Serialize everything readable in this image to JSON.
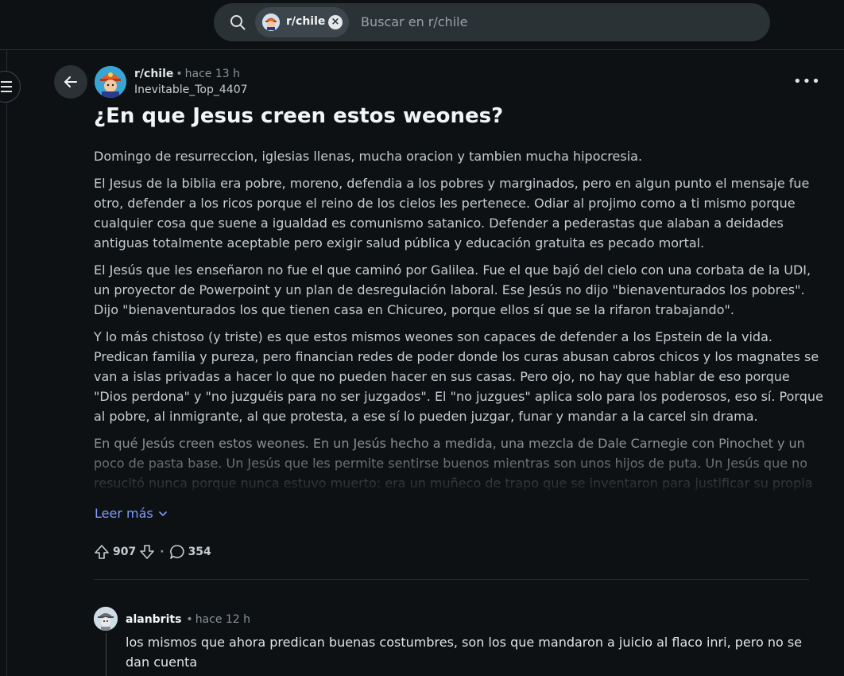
{
  "search": {
    "chip_label": "r/chile",
    "placeholder": "Buscar en r/chile"
  },
  "post": {
    "subreddit": "r/chile",
    "time": "hace 13 h",
    "author": "Inevitable_Top_4407",
    "title": "¿En que Jesus creen estos weones?",
    "paragraphs": [
      "Domingo de resurreccion, iglesias llenas, mucha oracion y tambien mucha hipocresia.",
      "El Jesus de la biblia era pobre, moreno, defendia a los pobres y marginados, pero en algun punto el mensaje fue otro, defender a los ricos porque el reino de los cielos les pertenece. Odiar al projimo como a ti mismo porque cualquier cosa que suene a igualdad es comunismo satanico. Defender a pederastas que alaban a deidades antiguas totalmente aceptable pero exigir salud pública y educación gratuita es pecado mortal.",
      "El Jesús que les enseñaron no fue el que caminó por Galilea. Fue el que bajó del cielo con una corbata de la UDI, un proyector de Powerpoint y un plan de desregulación laboral. Ese Jesús no dijo \"bienaventurados los pobres\". Dijo \"bienaventurados los que tienen casa en Chicureo, porque ellos sí que se la rifaron trabajando\".",
      "Y lo más chistoso (y triste) es que estos mismos weones son capaces de defender a los Epstein de la vida. Predican familia y pureza, pero financian redes de poder donde los curas abusan cabros chicos y los magnates se van a islas privadas a hacer lo que no pueden hacer en sus casas. Pero ojo, no hay que hablar de eso porque \"Dios perdona\" y \"no juzguéis para no ser juzgados\". El \"no juzgues\" aplica solo para los poderosos, eso sí. Porque al pobre, al inmigrante, al que protesta, a ese sí lo pueden juzgar, funar y mandar a la carcel sin drama.",
      "En qué Jesús creen estos weones. En un Jesús hecho a medida, una mezcla de Dale Carnegie con Pinochet y un poco de pasta base. Un Jesús que les permite sentirse buenos mientras son unos hijos de puta. Un Jesús que no resucitó nunca porque nunca estuvo muerto: era un muñeco de trapo que se inventaron para justificar su propia falta de"
    ],
    "read_more": "Leer más",
    "upvotes": "907",
    "comments": "354"
  },
  "comment": {
    "user": "alanbrits",
    "time": "hace 12 h",
    "text": "los mismos que ahora predican buenas costumbres, son los que mandaron a juicio al flaco inri, pero no se dan cuenta"
  },
  "colors": {
    "background": "#0e1113",
    "link": "#7c9cff",
    "muted": "#8a9297"
  }
}
